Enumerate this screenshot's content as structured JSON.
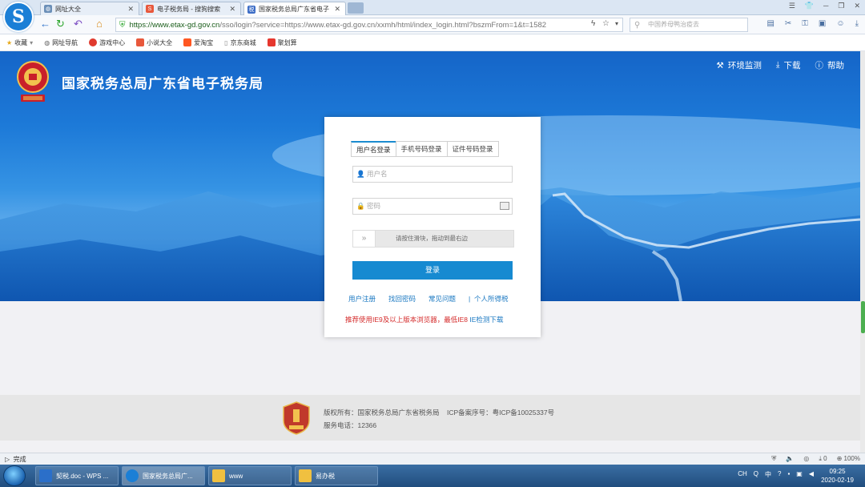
{
  "browser": {
    "tabs": [
      {
        "title": "网址大全",
        "icon": "globe-icon"
      },
      {
        "title": "电子税务局 - 搜狗搜索",
        "icon": "sogou-icon"
      },
      {
        "title": "国家税务总局广东省电子",
        "icon": "tax-bureau-icon"
      }
    ],
    "url_host": "https://www.etax-gd.gov.cn",
    "url_rest": "/sso/login?service=https://www.etax-gd.gov.cn/xxmh/html/index_login.html?bszmFrom=1&t=1582",
    "search_placeholder": "中国养母鸭治疫去"
  },
  "bookmarks": [
    {
      "label": "收藏",
      "icon": "star-icon"
    },
    {
      "label": "网址导航",
      "icon": "globe-icon"
    },
    {
      "label": "游戏中心",
      "icon": "game-icon"
    },
    {
      "label": "小说大全",
      "icon": "book-icon"
    },
    {
      "label": "爱淘宝",
      "icon": "taobao-icon"
    },
    {
      "label": "京东商城",
      "icon": "page-icon"
    },
    {
      "label": "聚划算",
      "icon": "juhuasuan-icon"
    }
  ],
  "header": {
    "site_title": "国家税务总局广东省电子税务局",
    "nav": {
      "env_check": "环境监测",
      "download": "下载",
      "help": "帮助"
    }
  },
  "login": {
    "tabs": [
      "用户名登录",
      "手机号码登录",
      "证件号码登录"
    ],
    "username_placeholder": "用户名",
    "password_placeholder": "密码",
    "slider_text": "请按住滑块，拖动到最右边",
    "login_button": "登录",
    "links": {
      "register": "用户注册",
      "forgot": "找回密码",
      "faq": "常见问题",
      "personal_tax": "个人所得税"
    },
    "tip_text": "推荐使用IE9及以上版本浏览器，最低IE8",
    "tip_link": "IE检测下载"
  },
  "footer": {
    "copyright": "版权所有：国家税务总局广东省税务局",
    "icp": "ICP备案序号：粤ICP备10025337号",
    "phone": "服务电话：12366"
  },
  "status": {
    "text": "完成",
    "download_count": "0",
    "zoom": "100%"
  },
  "taskbar": {
    "tasks": [
      "契税.doc - WPS ...",
      "国家税务总局广...",
      "www",
      "易办税"
    ],
    "lang": "CH",
    "ime": "中",
    "time": "09:25",
    "date": "2020-02-19"
  },
  "colors": {
    "accent": "#168ad1",
    "hero_top": "#1565c8",
    "tip_red": "#d42a2a"
  }
}
